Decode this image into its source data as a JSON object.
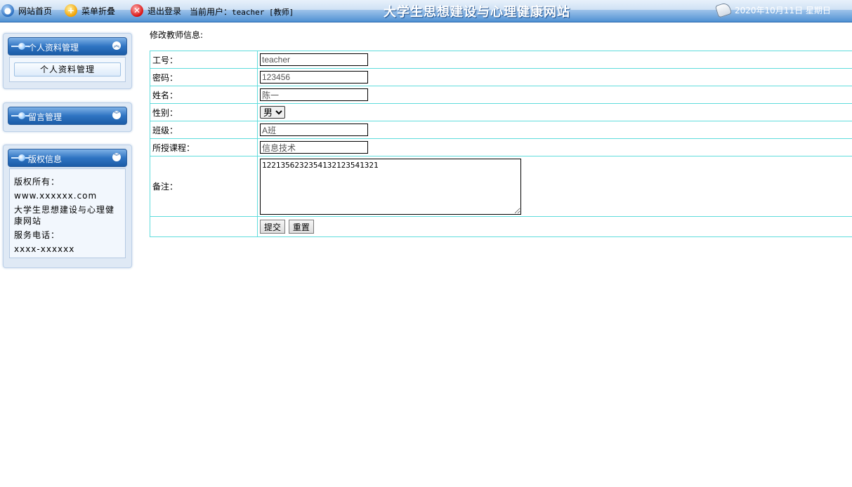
{
  "topbar": {
    "home_label": "网站首页",
    "collapse_label": "菜单折叠",
    "logout_label": "退出登录",
    "user_prefix": "当前用户：",
    "user_value": "teacher [教师]",
    "site_title": "大学生思想建设与心理健康网站",
    "date_text": "2020年10月11日 星期日"
  },
  "sidebar": {
    "panel1": {
      "title": "个人资料管理",
      "items": [
        {
          "label": "个人资料管理"
        }
      ]
    },
    "panel2": {
      "title": "留言管理"
    },
    "panel3": {
      "title": "版权信息",
      "lines": [
        "版权所有：",
        "www.xxxxxx.com",
        "大学生思想建设与心理健康网站",
        "服务电话：",
        "xxxx-xxxxxx"
      ]
    }
  },
  "form": {
    "title": "修改教师信息:",
    "fields": {
      "id": {
        "label": "工号：",
        "value": "teacher"
      },
      "pwd": {
        "label": "密码：",
        "value": "123456"
      },
      "name": {
        "label": "姓名：",
        "value": "陈一"
      },
      "gender": {
        "label": "性别：",
        "value": "男"
      },
      "class": {
        "label": "班级：",
        "value": "A班"
      },
      "course": {
        "label": "所授课程：",
        "value": "信息技术"
      },
      "note": {
        "label": "备注：",
        "value": "12213562323541321235413​21"
      }
    },
    "submit_label": "提交",
    "reset_label": "重置"
  },
  "colors": {
    "topbar_blue": "#4f90d3",
    "table_border": "#5fdcdc",
    "panel_bg": "#dfe9f5"
  }
}
